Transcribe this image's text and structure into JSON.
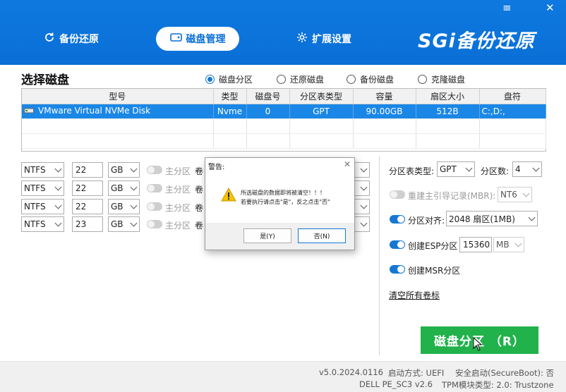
{
  "window": {
    "minimize_glyph": "—",
    "menu_glyph": "≡",
    "close_glyph": "✕"
  },
  "tabs": [
    {
      "label": "备份还原",
      "icon": "refresh-icon"
    },
    {
      "label": "磁盘管理",
      "icon": "disk-icon"
    },
    {
      "label": "扩展设置",
      "icon": "gear-icon"
    }
  ],
  "logo": "SGi备份还原",
  "section_title": "选择磁盘",
  "radios": [
    {
      "label": "磁盘分区",
      "checked": true
    },
    {
      "label": "还原磁盘",
      "checked": false
    },
    {
      "label": "备份磁盘",
      "checked": false
    },
    {
      "label": "克隆磁盘",
      "checked": false
    }
  ],
  "table": {
    "headers": [
      "型号",
      "类型",
      "磁盘号",
      "分区表类型",
      "容量",
      "扇区大小",
      "盘符"
    ],
    "rows": [
      [
        "VMware Virtual NVMe Disk",
        "Nvme",
        "0",
        "GPT",
        "90.00GB",
        "512B",
        "C:,D:,"
      ]
    ]
  },
  "partitions": [
    {
      "fs": "NTFS",
      "size": "22",
      "unit": "GB",
      "primary_label": "主分区",
      "vol_label": "卷"
    },
    {
      "fs": "NTFS",
      "size": "22",
      "unit": "GB",
      "primary_label": "主分区",
      "vol_label": "卷"
    },
    {
      "fs": "NTFS",
      "size": "22",
      "unit": "GB",
      "primary_label": "主分区",
      "vol_label": "卷"
    },
    {
      "fs": "NTFS",
      "size": "23",
      "unit": "GB",
      "primary_label": "主分区",
      "vol_label": "卷"
    }
  ],
  "options": {
    "table_type_label": "分区表类型:",
    "table_type_value": "GPT",
    "count_label": "分区数:",
    "count_value": "4",
    "rebuild_mbr_label": "重建主引导记录(MBR):",
    "rebuild_mbr_value": "NT6",
    "align_label": "分区对齐:",
    "align_value": "2048 扇区(1MB)",
    "esp_label": "创建ESP分区",
    "esp_size": "15360",
    "esp_unit": "MB",
    "msr_label": "创建MSR分区"
  },
  "clear_link": "清空所有卷标",
  "partition_button": "磁盘分区 （R）",
  "footer": {
    "version": "v5.0.2024.0116",
    "boot_mode": "启动方式:  UEFI",
    "secure_boot": "安全启动(SecureBoot):  否",
    "machine": "DELL  PE_SC3  v2.6",
    "tpm": "TPM模块类型:  2.0: Trustzone"
  },
  "dialog": {
    "title": "警告:",
    "message_line1": "所选磁盘的数据即将被清空！！！",
    "message_line2": "若要执行请点击\"是\"，反之点击\"否\"",
    "yes_label": "是(Y)",
    "no_label": "否(N)"
  },
  "colors": {
    "header": "#0a6fd6",
    "accent": "#1677d2",
    "go_button": "#21b24b"
  }
}
